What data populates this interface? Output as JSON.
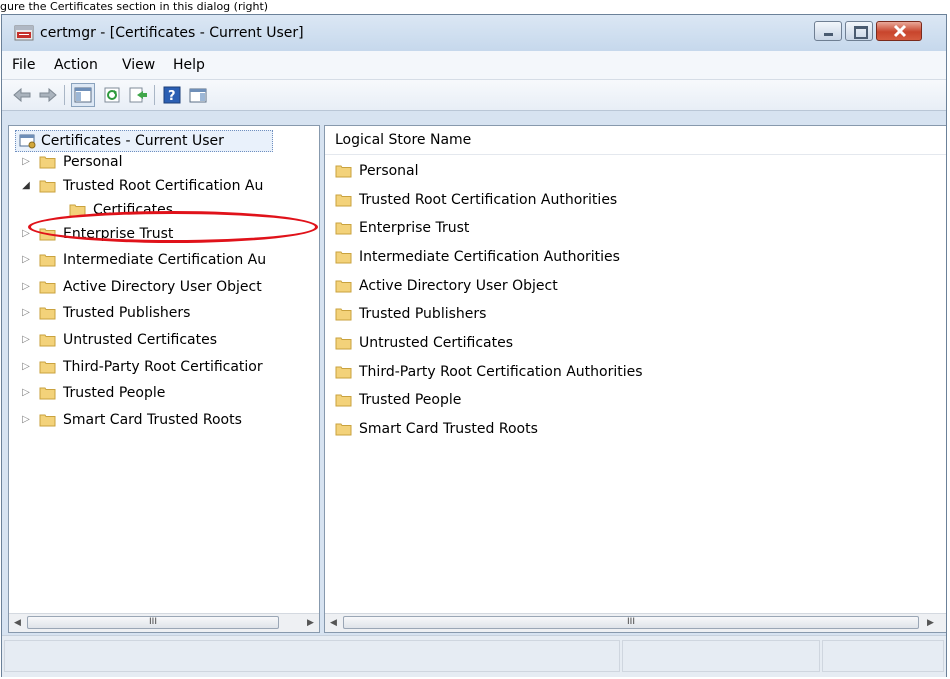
{
  "caption": "gure the Certificates section in this dialog (right)",
  "window": {
    "title": "certmgr - [Certificates - Current User]"
  },
  "menu": [
    "File",
    "Action",
    "View",
    "Help"
  ],
  "toolbar": {
    "icons": [
      "back-arrow-icon",
      "forward-arrow-icon",
      "show-hide-console-tree-icon",
      "refresh-icon",
      "export-list-icon",
      "help-icon",
      "action-pane-icon"
    ]
  },
  "tree": {
    "root": "Certificates - Current User",
    "items": [
      {
        "label": "Personal",
        "expander": "▷"
      },
      {
        "label": "Trusted Root Certification Au",
        "expander": "◢"
      },
      {
        "label": "Certificates",
        "expander": ""
      },
      {
        "label": "Enterprise Trust",
        "expander": "▷"
      },
      {
        "label": "Intermediate Certification Au",
        "expander": "▷"
      },
      {
        "label": "Active Directory User Object",
        "expander": "▷"
      },
      {
        "label": "Trusted Publishers",
        "expander": "▷"
      },
      {
        "label": "Untrusted Certificates",
        "expander": "▷"
      },
      {
        "label": "Third-Party Root Certificatior",
        "expander": "▷"
      },
      {
        "label": "Trusted People",
        "expander": "▷"
      },
      {
        "label": "Smart Card Trusted Roots",
        "expander": "▷"
      }
    ]
  },
  "list": {
    "column_header": "Logical Store Name",
    "items": [
      "Personal",
      "Trusted Root Certification Authorities",
      "Enterprise Trust",
      "Intermediate Certification Authorities",
      "Active Directory User Object",
      "Trusted Publishers",
      "Untrusted Certificates",
      "Third-Party Root Certification Authorities",
      "Trusted People",
      "Smart Card Trusted Roots"
    ]
  },
  "scrollbar": {
    "left_arrow": "◀",
    "right_arrow": "▶",
    "thumb_grip": "III"
  },
  "colors": {
    "highlight": "#e0121a",
    "folder": "#f3d27a"
  }
}
